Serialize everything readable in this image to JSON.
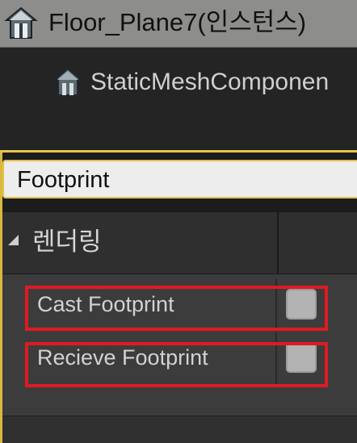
{
  "tree": {
    "root_label": "Floor_Plane7(인스턴스)",
    "root_icon": "actor-house-icon",
    "child_label": "StaticMeshComponen",
    "child_icon": "component-house-icon"
  },
  "details": {
    "search_value": "Footprint",
    "category_label": "렌더링",
    "category_icon": "collapse-arrow-icon",
    "properties": [
      {
        "label": "Cast Footprint",
        "checked": false
      },
      {
        "label": "Recieve Footprint",
        "checked": false
      }
    ]
  },
  "colors": {
    "panel_accent": "#e6c84b",
    "highlight_box": "#e01a22",
    "selected_row": "#8d8d8c"
  }
}
